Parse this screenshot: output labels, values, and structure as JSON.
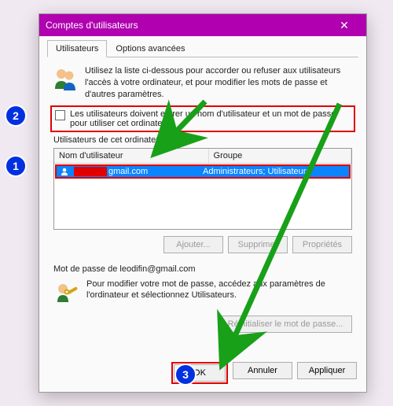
{
  "window": {
    "title": "Comptes d'utilisateurs",
    "close_glyph": "✕"
  },
  "tabs": {
    "users": "Utilisateurs",
    "advanced": "Options avancées"
  },
  "intro": "Utilisez la liste ci-dessous pour accorder ou refuser aux utilisateurs l'accès à votre ordinateur, et pour modifier les mots de passe et d'autres paramètres.",
  "checkbox_label": "Les utilisateurs doivent entrer un nom d'utilisateur et un mot de passe pour utiliser cet ordinateur.",
  "list_heading": "Utilisateurs de cet ordinateur :",
  "columns": {
    "name": "Nom d'utilisateur",
    "group": "Groupe"
  },
  "users": [
    {
      "name_censored": "xxxxxxxx",
      "name_suffix": "gmail.com",
      "group": "Administrateurs; Utilisateurs",
      "selected": true
    }
  ],
  "buttons": {
    "add": "Ajouter...",
    "remove": "Supprimer",
    "properties": "Propriétés",
    "reset_pw": "Réinitialiser le mot de passe...",
    "ok": "OK",
    "cancel": "Annuler",
    "apply": "Appliquer"
  },
  "password_section": {
    "title": "Mot de passe de leodifin@gmail.com",
    "body": "Pour modifier votre mot de passe, accédez aux paramètres de l'ordinateur et sélectionnez Utilisateurs."
  },
  "annotations": {
    "b1": "1",
    "b2": "2",
    "b3": "3"
  },
  "colors": {
    "titlebar": "#b000b0",
    "highlight_selection": "#0a84ff",
    "highlight_box": "#e00000",
    "badge": "#0030e0",
    "arrow": "#18a018"
  }
}
